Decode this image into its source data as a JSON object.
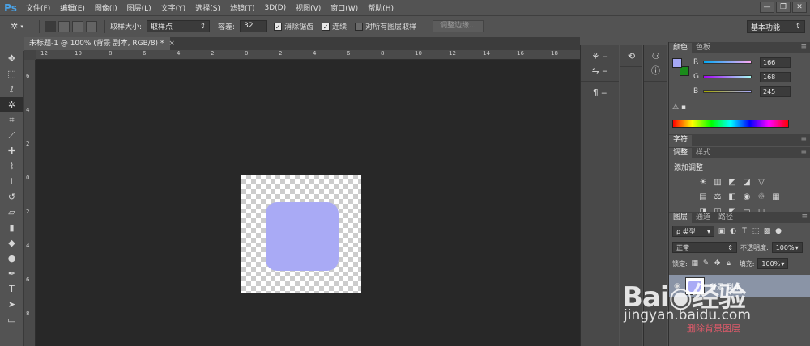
{
  "app": {
    "logo": "Ps"
  },
  "menu": [
    "文件(F)",
    "编辑(E)",
    "图像(I)",
    "图层(L)",
    "文字(Y)",
    "选择(S)",
    "滤镜(T)",
    "3D(D)",
    "视图(V)",
    "窗口(W)",
    "帮助(H)"
  ],
  "window_controls": {
    "minimize": "—",
    "restore": "❐",
    "close": "✕"
  },
  "options": {
    "sample_size_label": "取样大小:",
    "sample_size_value": "取样点",
    "tolerance_label": "容差:",
    "tolerance_value": "32",
    "antialias_label": "消除锯齿",
    "antialias_checked": true,
    "contiguous_label": "连续",
    "contiguous_checked": true,
    "all_layers_label": "对所有图层取样",
    "all_layers_checked": false,
    "refine_edge_label": "调整边缘...",
    "workspace_value": "基本功能"
  },
  "document": {
    "tab_title": "未标题-1 @ 100% (背景 副本, RGB/8) *",
    "tab_close": "×",
    "ruler_h_ticks": [
      "12",
      "10",
      "8",
      "6",
      "4",
      "2",
      "0",
      "2",
      "4",
      "6",
      "8",
      "10",
      "12",
      "14",
      "16",
      "18"
    ],
    "ruler_v_ticks": [
      "6",
      "4",
      "2",
      "0",
      "2",
      "4",
      "6",
      "8"
    ],
    "shape_color": "#a9aaf5"
  },
  "tools": [
    "move-icon",
    "marquee-icon",
    "lasso-icon",
    "magic-wand-icon",
    "crop-icon",
    "eyedropper-icon",
    "healing-icon",
    "brush-icon",
    "stamp-icon",
    "history-brush-icon",
    "eraser-icon",
    "gradient-icon",
    "blur-icon",
    "dodge-icon",
    "pen-icon",
    "type-icon",
    "path-select-icon",
    "rectangle-icon"
  ],
  "color_panel": {
    "tabs": [
      "颜色",
      "色板"
    ],
    "fg_color": "#a6a8f5",
    "bg_color": "#1a8a1a",
    "r_label": "R",
    "r_value": "166",
    "g_label": "G",
    "g_value": "168",
    "b_label": "B",
    "b_value": "245"
  },
  "character_tab": "字符",
  "adjustments": {
    "tabs": [
      "调整",
      "样式"
    ],
    "title": "添加调整"
  },
  "layers": {
    "tabs": [
      "图层",
      "通道",
      "路径"
    ],
    "filter_value": "ρ 类型",
    "blend_mode": "正常",
    "opacity_label": "不透明度:",
    "opacity_value": "100%",
    "lock_label": "锁定:",
    "fill_label": "填充:",
    "fill_value": "100%",
    "layer_name": "背景 副本"
  },
  "watermark": {
    "logo": "Bai◉经验",
    "url": "jingyan.baidu.com",
    "note": "删除背景图层"
  }
}
